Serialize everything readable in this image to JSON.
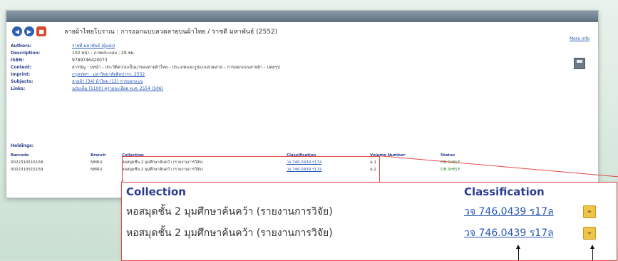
{
  "record": {
    "title": "ลายผ้าไทยโบราณ : การออกแบบลวดลายบนผ้าไทย / ราชดี มหาพันธ์ (2552)"
  },
  "links": {
    "more_info": "More info"
  },
  "fields": [
    {
      "label": "Authors:",
      "value": "ราชดี มหาพันธ์ (ผู้แต่ง)"
    },
    {
      "label": "Description:",
      "value": "102 หน้า : ภาพประกอบ ; 29 ซม."
    },
    {
      "label": "ISBN:",
      "value": "9789746420073"
    },
    {
      "label": "Content:",
      "value": "สารบัญ : บทนำ - ประวัติความเป็นมาของลายผ้าไทย - ประเภทและรูปแบบลวดลาย - การออกแบบลายผ้า - บทสรุป"
    },
    {
      "label": "Imprint:",
      "value": "กรุงเทพฯ : มหาวิทยาลัยศิลปากร, 2552"
    },
    {
      "label": "Subjects:",
      "value": "ลายผ้า  (34)  ผ้าไทย  (12)  การออกแบบ"
    },
    {
      "label": "Links:",
      "value": "ฉบับเต็ม  (1100)  ดูรายละเอียด พ.ศ. 2554  (506)"
    }
  ],
  "holdings": {
    "label": "Holdings:",
    "headers": [
      "Barcode",
      "Branch",
      "Collection",
      "Classification",
      "Volume Number",
      "Status"
    ],
    "rows": [
      {
        "barcode": "0022310515158",
        "branch": "NMRU",
        "collection": "หอสมุดชั้น 2 มุมศึกษาค้นคว้า (รายงานการวิจัย)",
        "classification": "วจ 746.0439 ร17ล",
        "volume": "ฉ.1",
        "status": "ON SHELF"
      },
      {
        "barcode": "0022310515159",
        "branch": "NMRU",
        "collection": "หอสมุดชั้น 2 มุมศึกษาค้นคว้า (รายงานการวิจัย)",
        "classification": "วจ 746.0439 ร17ล",
        "volume": "ฉ.2",
        "status": "ON SHELF"
      }
    ]
  },
  "zoom": {
    "header_collection": "Collection",
    "header_classification": "Classification",
    "rows": [
      {
        "collection": "หอสมุดชั้น 2 มุมศึกษาค้นคว้า (รายงานการวิจัย)",
        "classification": "วจ 746.0439 ร17ล"
      },
      {
        "collection": "หอสมุดชั้น 2 มุมศึกษาค้นคว้า (รายงานการวิจัย)",
        "classification": "วจ 746.0439 ร17ล"
      }
    ]
  },
  "icons": {
    "back": "back-icon",
    "forward": "forward-icon",
    "book": "book-icon",
    "save": "save-icon",
    "map": "map-icon"
  }
}
